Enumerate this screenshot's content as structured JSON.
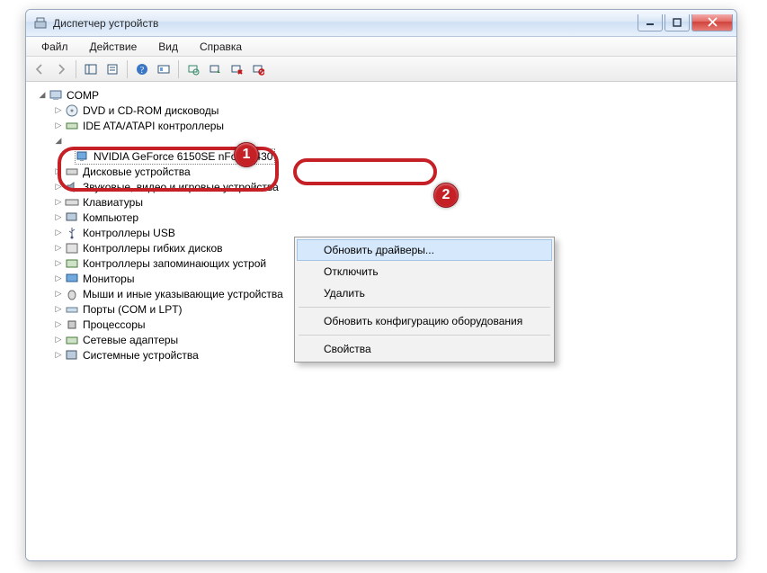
{
  "window": {
    "title": "Диспетчер устройств"
  },
  "menubar": {
    "file": "Файл",
    "action": "Действие",
    "view": "Вид",
    "help": "Справка"
  },
  "tree": {
    "root": "COMP",
    "items": [
      "DVD и CD-ROM дисководы",
      "IDE ATA/ATAPI контроллеры"
    ],
    "selected_device": "NVIDIA GeForce 6150SE nForce 430",
    "items2": [
      "Дисковые устройства",
      "Звуковые, видео и игровые устройства",
      "Клавиатуры",
      "Компьютер",
      "Контроллеры USB",
      "Контроллеры гибких дисков",
      "Контроллеры запоминающих устрой",
      "Мониторы",
      "Мыши и иные указывающие устройства",
      "Порты (COM и LPT)",
      "Процессоры",
      "Сетевые адаптеры",
      "Системные устройства"
    ]
  },
  "context_menu": {
    "update": "Обновить драйверы...",
    "disable": "Отключить",
    "delete": "Удалить",
    "scan": "Обновить конфигурацию оборудования",
    "props": "Свойства"
  },
  "callouts": {
    "one": "1",
    "two": "2"
  }
}
